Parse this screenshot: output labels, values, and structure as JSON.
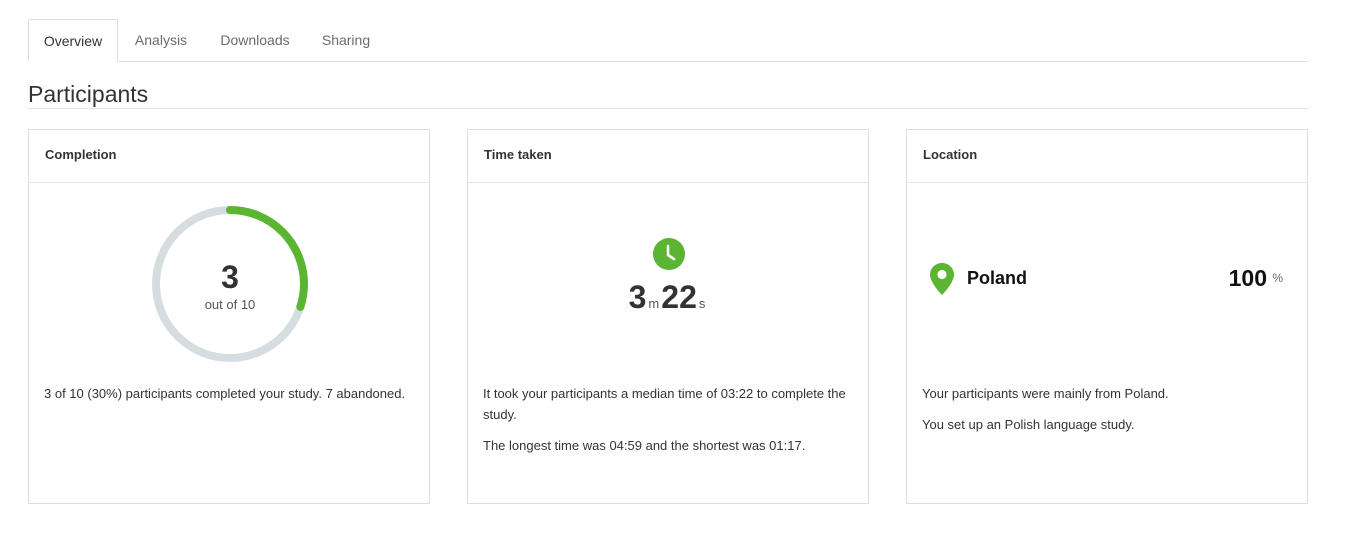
{
  "tabs": [
    {
      "label": "Overview",
      "active": true
    },
    {
      "label": "Analysis",
      "active": false
    },
    {
      "label": "Downloads",
      "active": false
    },
    {
      "label": "Sharing",
      "active": false
    }
  ],
  "section": {
    "title": "Participants"
  },
  "completion": {
    "header": "Completion",
    "count": "3",
    "out_of": "out of 10",
    "fraction_complete": 0.3,
    "summary": "3 of 10 (30%) participants completed your study. 7 abandoned."
  },
  "time_taken": {
    "header": "Time taken",
    "icon": "clock-icon",
    "minutes": "3",
    "minutes_unit": "m",
    "seconds": "22",
    "seconds_unit": "s",
    "text_1": "It took your participants a median time of 03:22 to complete the study.",
    "text_2": "The longest time was 04:59 and the shortest was 01:17."
  },
  "location": {
    "header": "Location",
    "icon": "location-pin-icon",
    "country": "Poland",
    "percent": "100",
    "percent_sign": "%",
    "text_1": "Your participants were mainly from Poland.",
    "text_2": "You set up an Polish language study."
  },
  "colors": {
    "accent_green": "#5bb432",
    "ring_track": "#d5dde0",
    "border": "#dedede"
  }
}
